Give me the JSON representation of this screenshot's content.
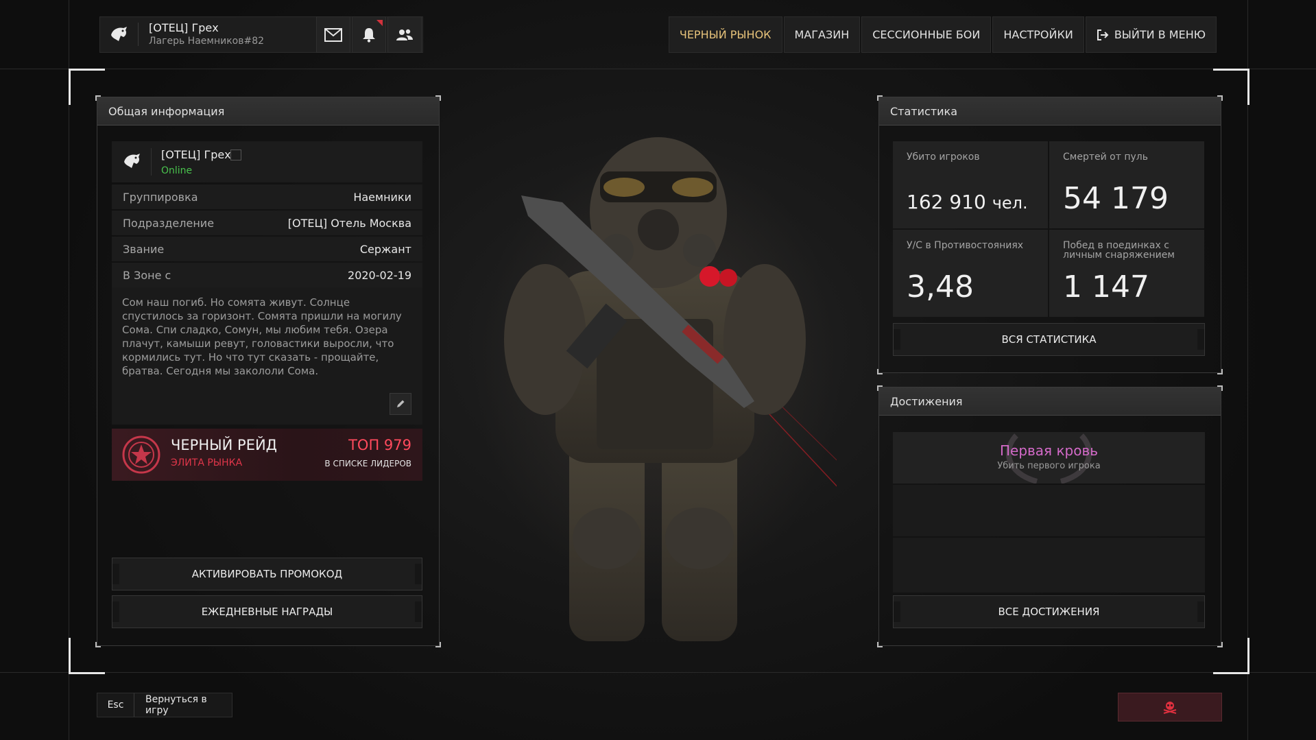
{
  "header": {
    "player_name": "[ОТЕЦ] Грех",
    "player_camp": "Лагерь Наемников#82",
    "nav": [
      "ЧЕРНЫЙ РЫНОК",
      "МАГАЗИН",
      "СЕССИОННЫЕ БОИ",
      "НАСТРОЙКИ",
      "ВЫЙТИ В МЕНЮ"
    ],
    "icons": [
      "mail-icon",
      "bell-icon",
      "friends-icon",
      "logout-icon"
    ]
  },
  "general": {
    "title": "Общая информация",
    "name": "[ОТЕЦ] Грех",
    "status": "Online",
    "rows": [
      {
        "key": "Группировка",
        "value": "Наемники"
      },
      {
        "key": "Подразделение",
        "value": "[ОТЕЦ] Отель Москва"
      },
      {
        "key": "Звание",
        "value": "Сержант"
      },
      {
        "key": "В Зоне с",
        "value": "2020-02-19"
      }
    ],
    "bio": "Сом наш погиб. Но сомята живут. Солнце спустилось за горизонт. Сомята пришли на могилу Сома. Спи сладко, Сомун, мы любим тебя. Озера плачут, камыши ревут, головастики выросли, что кормились тут. Но что тут сказать - прощайте, братва. Сегодня мы закололи Сома.",
    "raid": {
      "title": "ЧЕРНЫЙ РЕЙД",
      "subtitle": "ЭЛИТА РЫНКА",
      "top": "ТОП 979",
      "list": "В СПИСКЕ ЛИДЕРОВ"
    },
    "promo_button": "АКТИВИРОВАТЬ ПРОМОКОД",
    "daily_button": "ЕЖЕДНЕВНЫЕ НАГРАДЫ"
  },
  "stats": {
    "title": "Статистика",
    "items": [
      {
        "label": "Убито игроков",
        "value": "162 910",
        "unit": "чел."
      },
      {
        "label": "Смертей от пуль",
        "value": "54 179"
      },
      {
        "label": "У/С в Противостояниях",
        "value": "3,48"
      },
      {
        "label": "Побед в поединках с личным снаряжением",
        "value": "1 147"
      }
    ],
    "all_button": "ВСЯ СТАТИСТИКА"
  },
  "achievements": {
    "title": "Достижения",
    "items": [
      {
        "title": "Первая кровь",
        "desc": "Убить первого игрока"
      }
    ],
    "all_button": "ВСЕ ДОСТИЖЕНИЯ"
  },
  "footer": {
    "esc_key": "Esc",
    "esc_label": "Вернуться в игру"
  },
  "colors": {
    "accent_gold": "#e6c27a",
    "online_green": "#49c24d",
    "raid_red": "#ff4a5d",
    "achievement_pink": "#d36ac8"
  }
}
